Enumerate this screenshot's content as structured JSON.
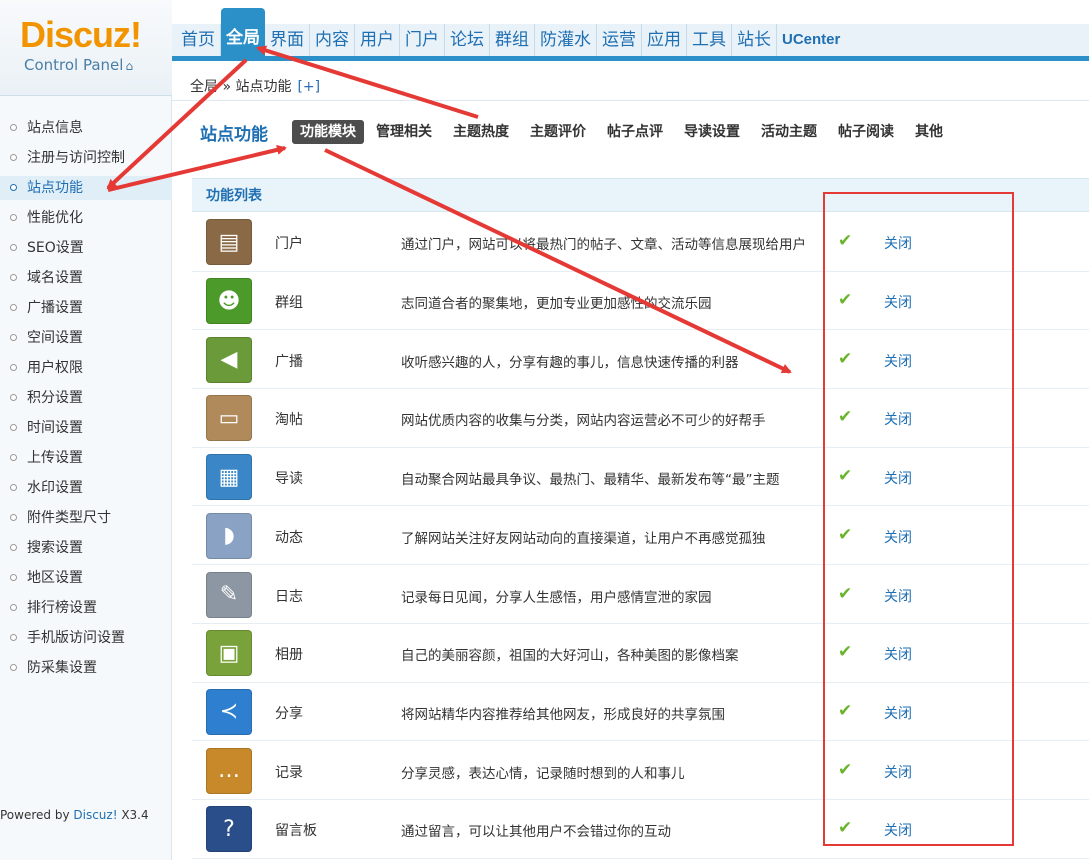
{
  "logo": {
    "brand": "Discuz!",
    "subtitle": "Control Panel"
  },
  "nav": [
    "首页",
    "全局",
    "界面",
    "内容",
    "用户",
    "门户",
    "论坛",
    "群组",
    "防灌水",
    "运营",
    "应用",
    "工具",
    "站长",
    "UCenter"
  ],
  "nav_active": "全局",
  "breadcrumb": {
    "text": "全局 » 站点功能",
    "add": "[+]"
  },
  "sidebar": {
    "items": [
      "站点信息",
      "注册与访问控制",
      "站点功能",
      "性能优化",
      "SEO设置",
      "域名设置",
      "广播设置",
      "空间设置",
      "用户权限",
      "积分设置",
      "时间设置",
      "上传设置",
      "水印设置",
      "附件类型尺寸",
      "搜索设置",
      "地区设置",
      "排行榜设置",
      "手机版访问设置",
      "防采集设置"
    ],
    "active": "站点功能"
  },
  "footer": {
    "powered_prefix": "Powered by ",
    "brand": "Discuz!",
    "version": " X3.4"
  },
  "main": {
    "section_title": "站点功能",
    "tabs": [
      "功能模块",
      "管理相关",
      "主题热度",
      "主题评价",
      "帖子点评",
      "导读设置",
      "活动主题",
      "帖子阅读",
      "其他"
    ],
    "active_tab": "功能模块",
    "list_title": "功能列表",
    "check_glyph": "✔",
    "rows": [
      {
        "name": "门户",
        "desc": "通过门户，网站可以将最热门的帖子、文章、活动等信息展现给用户",
        "toggle": "关闭",
        "icon": "portal-icon",
        "color": "#8a6a46",
        "glyph": "▤"
      },
      {
        "name": "群组",
        "desc": "志同道合者的聚集地，更加专业更加感性的交流乐园",
        "toggle": "关闭",
        "icon": "group-icon",
        "color": "#4c9a2a",
        "glyph": "☻"
      },
      {
        "name": "广播",
        "desc": "收听感兴趣的人，分享有趣的事儿，信息快速传播的利器",
        "toggle": "关闭",
        "icon": "megaphone-icon",
        "color": "#6a9a3a",
        "glyph": "◀"
      },
      {
        "name": "淘帖",
        "desc": "网站优质内容的收集与分类，网站内容运营必不可少的好帮手",
        "toggle": "关闭",
        "icon": "tray-icon",
        "color": "#b08a5a",
        "glyph": "▭"
      },
      {
        "name": "导读",
        "desc": "自动聚合网站最具争议、最热门、最精华、最新发布等“最”主题",
        "toggle": "关闭",
        "icon": "guide-icon",
        "color": "#3a86c6",
        "glyph": "▦"
      },
      {
        "name": "动态",
        "desc": "了解网站关注好友网站动向的直接渠道，让用户不再感觉孤独",
        "toggle": "关闭",
        "icon": "rss-icon",
        "color": "#8aa3c4",
        "glyph": "◗"
      },
      {
        "name": "日志",
        "desc": "记录每日见闻，分享人生感悟，用户感情宣泄的家园",
        "toggle": "关闭",
        "icon": "blog-icon",
        "color": "#8d97a3",
        "glyph": "✎"
      },
      {
        "name": "相册",
        "desc": "自己的美丽容颜，祖国的大好河山，各种美图的影像档案",
        "toggle": "关闭",
        "icon": "album-icon",
        "color": "#7aa23a",
        "glyph": "▣"
      },
      {
        "name": "分享",
        "desc": "将网站精华内容推荐给其他网友，形成良好的共享氛围",
        "toggle": "关闭",
        "icon": "share-icon",
        "color": "#2f7fd0",
        "glyph": "≺"
      },
      {
        "name": "记录",
        "desc": "分享灵感，表达心情，记录随时想到的人和事儿",
        "toggle": "关闭",
        "icon": "chat-icon",
        "color": "#c7892a",
        "glyph": "…"
      },
      {
        "name": "留言板",
        "desc": "通过留言，可以让其他用户不会错过你的互动",
        "toggle": "关闭",
        "icon": "guestbook-icon",
        "color": "#2a4e8a",
        "glyph": "?"
      }
    ]
  },
  "colors": {
    "accent": "#2b90c8",
    "link": "#1f6fb3",
    "annotation": "#e53935",
    "check": "#6ab42c"
  }
}
